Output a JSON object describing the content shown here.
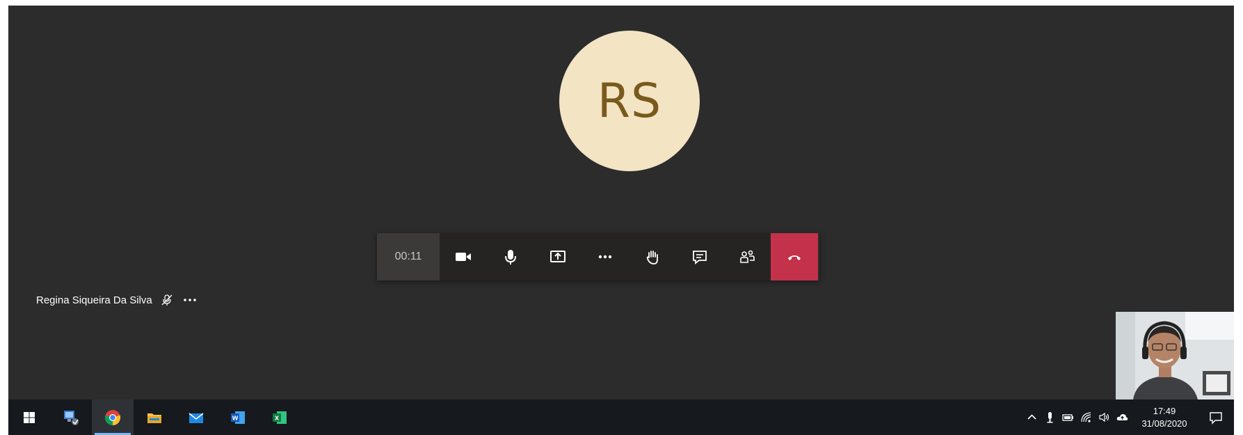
{
  "call": {
    "avatar_initials": "RS",
    "avatar_bg": "#f3e4c4",
    "avatar_text_color": "#7a5a1c",
    "timer": "00:11",
    "hangup_color": "#c4314b",
    "controls": [
      {
        "name": "camera-toggle",
        "icon": "video-camera-icon"
      },
      {
        "name": "mic-toggle",
        "icon": "microphone-icon"
      },
      {
        "name": "share-screen",
        "icon": "share-screen-icon"
      },
      {
        "name": "more-actions",
        "icon": "more-dots-icon"
      },
      {
        "name": "raise-hand",
        "icon": "raise-hand-icon"
      },
      {
        "name": "show-conversation",
        "icon": "chat-icon"
      },
      {
        "name": "show-participants",
        "icon": "people-icon"
      },
      {
        "name": "hang-up",
        "icon": "phone-hangup-icon"
      }
    ]
  },
  "participant": {
    "name": "Regina Siqueira Da Silva",
    "mic_icon": "muted-mic-icon",
    "more_icon": "more-dots-icon"
  },
  "taskbar": {
    "apps": [
      {
        "name": "start",
        "icon": "windows-start-icon"
      },
      {
        "name": "network-app",
        "icon": "network-computer-icon"
      },
      {
        "name": "chrome",
        "icon": "chrome-icon",
        "active": true
      },
      {
        "name": "file-explorer",
        "icon": "folder-icon"
      },
      {
        "name": "mail",
        "icon": "mail-icon"
      },
      {
        "name": "word",
        "icon": "word-icon"
      },
      {
        "name": "excel",
        "icon": "excel-icon"
      }
    ],
    "tray_icons": [
      "chevron-up-icon",
      "microphone-icon",
      "battery-icon",
      "wifi-icon",
      "speaker-icon",
      "onedrive-cloud-icon"
    ],
    "time": "17:49",
    "date": "31/08/2020"
  }
}
